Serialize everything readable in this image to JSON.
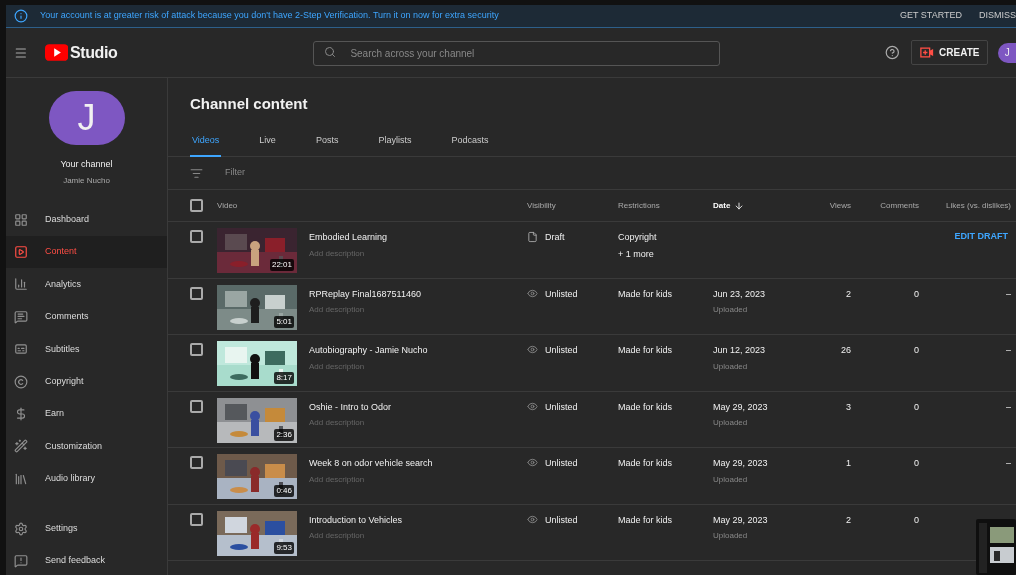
{
  "banner": {
    "message": "Your account is at greater risk of attack because you don't have 2-Step Verification. Turn it on now for extra security",
    "actions": [
      "GET STARTED",
      "DISMISS"
    ]
  },
  "topbar": {
    "logo": "Studio",
    "search": {
      "placeholder": "Search across your channel"
    },
    "create": "CREATE",
    "avatar": "J"
  },
  "sidebar": {
    "avatar": "J",
    "title": "Your channel",
    "name": "Jamie Nucho",
    "items": [
      {
        "label": "Dashboard",
        "selected": false
      },
      {
        "label": "Content",
        "selected": true
      },
      {
        "label": "Analytics",
        "selected": false
      },
      {
        "label": "Comments",
        "selected": false
      },
      {
        "label": "Subtitles",
        "selected": false
      },
      {
        "label": "Copyright",
        "selected": false
      },
      {
        "label": "Earn",
        "selected": false
      },
      {
        "label": "Customization",
        "selected": false
      },
      {
        "label": "Audio library",
        "selected": false
      }
    ],
    "footer_items": [
      "Settings",
      "Send feedback"
    ]
  },
  "page": {
    "title": "Channel content",
    "tabs": [
      {
        "label": "Videos",
        "selected": true
      },
      {
        "label": "Live",
        "selected": false
      },
      {
        "label": "Posts",
        "selected": false
      },
      {
        "label": "Playlists",
        "selected": false
      },
      {
        "label": "Podcasts",
        "selected": false
      }
    ],
    "filter": {
      "placeholder": "Filter"
    },
    "table": {
      "select_all": false,
      "columns": [
        "Video",
        "Visibility",
        "Restrictions",
        "Date",
        "Views",
        "Comments",
        "Likes (vs. dislikes)"
      ],
      "rows": [
        {
          "kind": "draft",
          "title": "Embodied Learning",
          "description": "Add description",
          "duration": "22:01",
          "visibility": "Draft",
          "restrictions": [
            "Copyright",
            "+ 1 more"
          ],
          "action": "EDIT DRAFT",
          "checked": false
        },
        {
          "kind": "uploaded",
          "title": "RPReplay Final1687511460",
          "description": "Add description",
          "duration": "5:01",
          "visibility": "Unlisted",
          "restrictions": [
            "Made for kids"
          ],
          "date": "Jun 23, 2023",
          "date_note": "Uploaded",
          "views": "2",
          "comments": "0",
          "likes": "–",
          "checked": false
        },
        {
          "kind": "uploaded",
          "title": "Autobiography - Jamie Nucho",
          "description": "Add description",
          "duration": "8:17",
          "visibility": "Unlisted",
          "restrictions": [
            "Made for kids"
          ],
          "date": "Jun 12, 2023",
          "date_note": "Uploaded",
          "views": "26",
          "comments": "0",
          "likes": "–",
          "checked": false
        },
        {
          "kind": "uploaded",
          "title": "Oshie - Intro to Odor",
          "description": "Add description",
          "duration": "2:36",
          "visibility": "Unlisted",
          "restrictions": [
            "Made for kids"
          ],
          "date": "May 29, 2023",
          "date_note": "Uploaded",
          "views": "3",
          "comments": "0",
          "likes": "–",
          "checked": false
        },
        {
          "kind": "uploaded",
          "title": "Week 8 on odor vehicle search",
          "description": "Add description",
          "duration": "0:46",
          "visibility": "Unlisted",
          "restrictions": [
            "Made for kids"
          ],
          "date": "May 29, 2023",
          "date_note": "Uploaded",
          "views": "1",
          "comments": "0",
          "likes": "–",
          "checked": false
        },
        {
          "kind": "uploaded",
          "title": "Introduction to Vehicles",
          "description": "Add description",
          "duration": "9:53",
          "visibility": "Unlisted",
          "restrictions": [
            "Made for kids"
          ],
          "date": "May 29, 2023",
          "date_note": "Uploaded",
          "views": "2",
          "comments": "0",
          "checked": false
        }
      ]
    }
  }
}
